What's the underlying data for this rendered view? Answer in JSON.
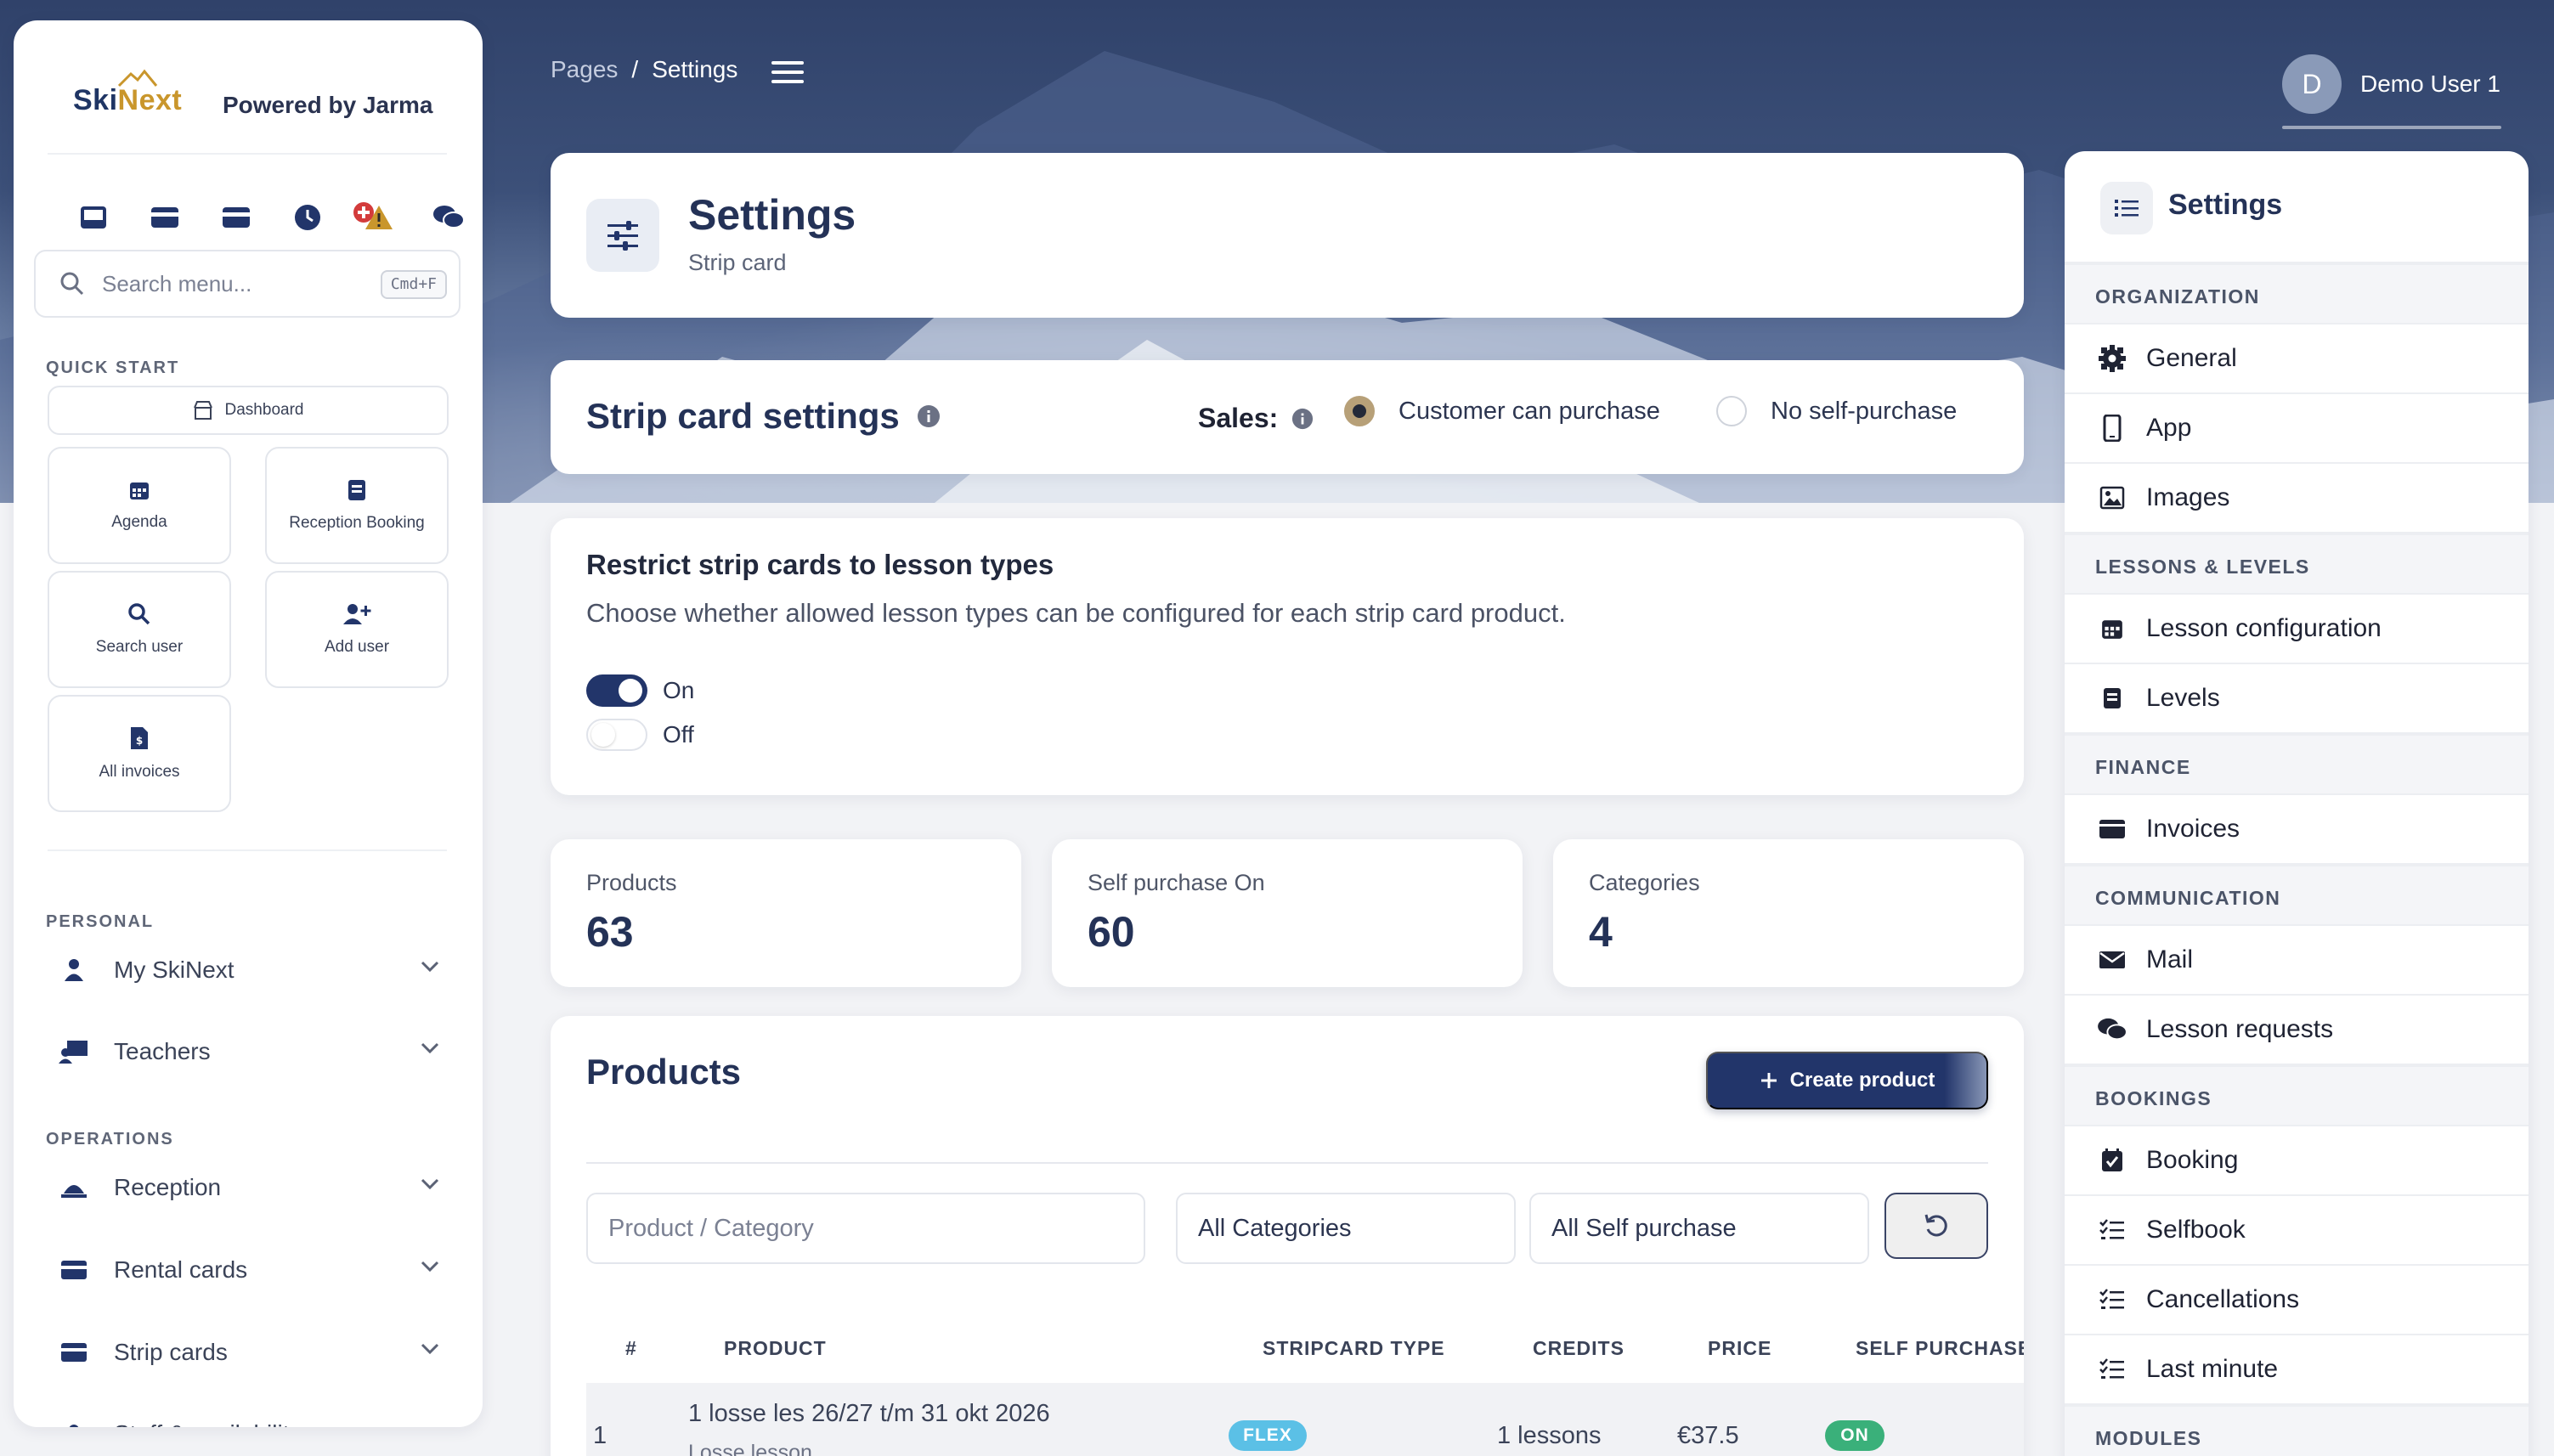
{
  "brand": {
    "logo_a": "Ski",
    "logo_b": "Next",
    "powered": "Powered by Jarma"
  },
  "search": {
    "placeholder": "Search menu...",
    "shortcut": "Cmd+F"
  },
  "quick_start": {
    "label": "QUICK START",
    "dashboard": "Dashboard",
    "tiles": [
      "Agenda",
      "Reception Booking",
      "Search user",
      "Add user",
      "All invoices"
    ]
  },
  "personal": {
    "label": "PERSONAL",
    "items": [
      "My SkiNext",
      "Teachers"
    ]
  },
  "operations": {
    "label": "OPERATIONS",
    "items": [
      "Reception",
      "Rental cards",
      "Strip cards",
      "Staff & availability"
    ]
  },
  "breadcrumb": {
    "root": "Pages",
    "sep": "/",
    "current": "Settings"
  },
  "user": {
    "initial": "D",
    "name": "Demo User 1"
  },
  "page": {
    "title": "Settings",
    "subtitle": "Strip card"
  },
  "strip_settings": {
    "title": "Strip card settings",
    "sales_label": "Sales:",
    "options": [
      "Customer can purchase",
      "No self-purchase"
    ],
    "selected": "Customer can purchase"
  },
  "restrict": {
    "title": "Restrict strip cards to lesson types",
    "description": "Choose whether allowed lesson types can be configured for each strip card product.",
    "on_label": "On",
    "off_label": "Off"
  },
  "stats": [
    {
      "label": "Products",
      "value": "63"
    },
    {
      "label": "Self purchase On",
      "value": "60"
    },
    {
      "label": "Categories",
      "value": "4"
    }
  ],
  "products": {
    "title": "Products",
    "create_label": "Create product",
    "filters": {
      "search_placeholder": "Product / Category",
      "category": "All Categories",
      "self_purchase": "All Self purchase"
    },
    "columns": [
      "#",
      "PRODUCT",
      "STRIPCARD TYPE",
      "CREDITS",
      "PRICE",
      "SELF PURCHASE"
    ],
    "rows": [
      {
        "num": "1",
        "product": "1 losse les 26/27 t/m 31 okt 2026",
        "sub": "Losse lesson",
        "type": "FLEX",
        "credits": "1 lessons",
        "price": "€37.5",
        "self": "ON"
      }
    ]
  },
  "settings_panel": {
    "title": "Settings",
    "sections": [
      {
        "label": "ORGANIZATION",
        "items": [
          "General",
          "App",
          "Images"
        ]
      },
      {
        "label": "LESSONS & LEVELS",
        "items": [
          "Lesson configuration",
          "Levels"
        ]
      },
      {
        "label": "FINANCE",
        "items": [
          "Invoices"
        ]
      },
      {
        "label": "COMMUNICATION",
        "items": [
          "Mail",
          "Lesson requests"
        ]
      },
      {
        "label": "BOOKINGS",
        "items": [
          "Booking",
          "Selfbook",
          "Cancellations",
          "Last minute"
        ]
      },
      {
        "label": "MODULES",
        "items": []
      }
    ]
  },
  "colors": {
    "navy": "#22356a",
    "accent": "#c9962c",
    "flex": "#5bc0e6",
    "on": "#3ab07a"
  }
}
